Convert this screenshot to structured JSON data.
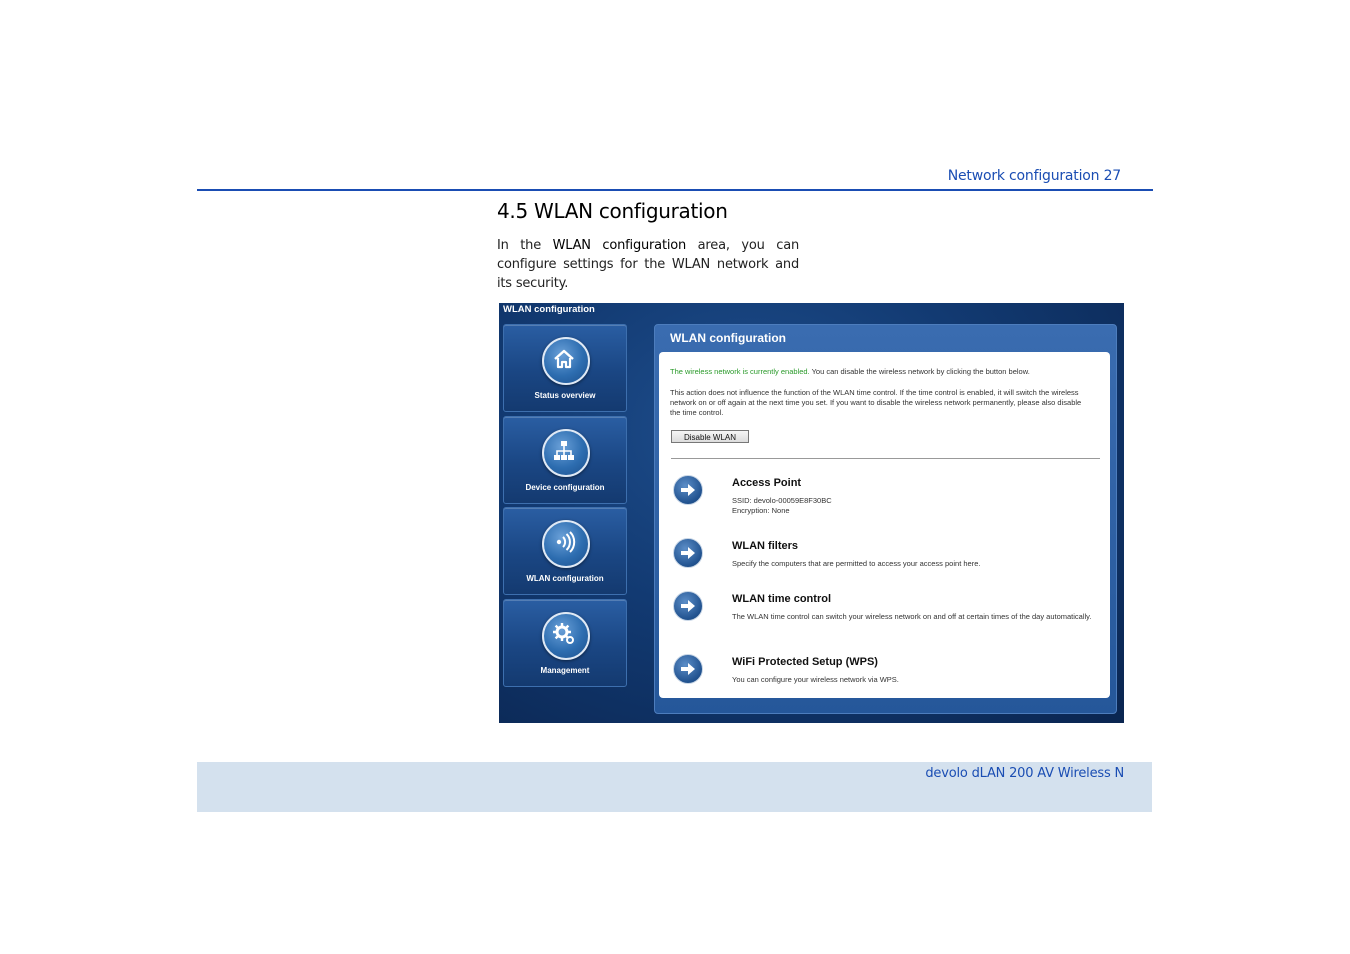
{
  "page": {
    "running_head": "Network configuration 27",
    "section_title": "4.5  WLAN configuration",
    "intro_prefix": "In the ",
    "intro_bold": "WLAN configuration",
    "intro_suffix": " area, you can configure settings for the WLAN network and its security.",
    "footer": "devolo dLAN 200 AV Wireless N"
  },
  "ui": {
    "window_title": "WLAN configuration",
    "nav": [
      {
        "label": "Status overview",
        "icon": "home-icon"
      },
      {
        "label": "Device configuration",
        "icon": "network-tree-icon"
      },
      {
        "label": "WLAN configuration",
        "icon": "wireless-icon"
      },
      {
        "label": "Management",
        "icon": "gear-icon"
      }
    ],
    "content_title": "WLAN configuration",
    "status_green": "The wireless network is currently enabled.",
    "status_rest": " You can disable the wireless network by clicking the button below.",
    "info": "This action does not influence the function of the WLAN time control. If the time control is enabled, it will switch the wireless network on or off again at the next time you set. If you want to disable the wireless network permanently, please also disable the time control.",
    "disable_button": "Disable WLAN",
    "items": [
      {
        "title": "Access Point",
        "desc_line1": "SSID: devolo-00059E8F30BC",
        "desc_line2": "Encryption: None"
      },
      {
        "title": "WLAN filters",
        "desc_line1": "Specify the computers that are permitted to access your access point here.",
        "desc_line2": ""
      },
      {
        "title": "WLAN time control",
        "desc_line1": "The WLAN time control can switch your wireless network on and off at certain times of the day automatically.",
        "desc_line2": ""
      },
      {
        "title": "WiFi Protected Setup (WPS)",
        "desc_line1": "You can configure your wireless network via WPS.",
        "desc_line2": ""
      }
    ]
  }
}
